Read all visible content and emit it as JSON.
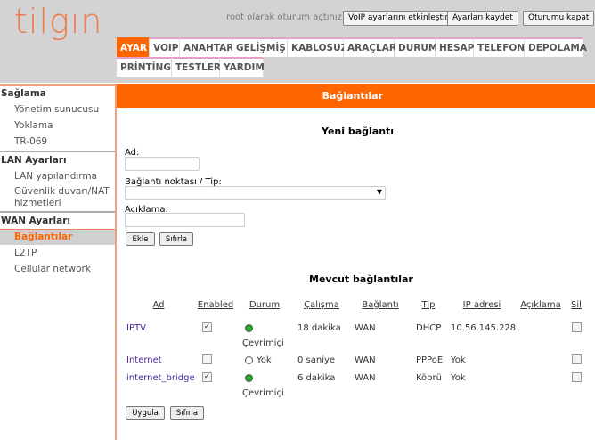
{
  "header": {
    "logo": "tilgın",
    "login_text": "root olarak oturum açtınız.",
    "buttons": [
      "VoIP ayarlarını etkinleştir",
      "Ayarları kaydet",
      "Oturumu kapat"
    ]
  },
  "nav": {
    "row1": [
      "AYAR",
      "VOIP",
      "ANAHTAR",
      "GELİŞMİŞ",
      "KABLOSUZ",
      "ARAÇLAR",
      "DURUM",
      "HESAP",
      "TELEFON",
      "DEPOLAMA"
    ],
    "row2": [
      "PRİNTİNG",
      "TESTLER",
      "YARDIM"
    ],
    "active": "AYAR"
  },
  "sidebar": {
    "sections": [
      {
        "title": "Sağlama",
        "items": [
          "Yönetim sunucusu",
          "Yoklama",
          "TR-069"
        ]
      },
      {
        "title": "LAN Ayarları",
        "items": [
          "LAN yapılandırma",
          "Güvenlik duvarı/NAT hizmetleri"
        ]
      },
      {
        "title": "WAN Ayarları",
        "items": [
          "Bağlantılar",
          "L2TP",
          "Cellular network"
        ]
      }
    ],
    "active": "Bağlantılar"
  },
  "page": {
    "title": "Bağlantılar",
    "new": {
      "heading": "Yeni bağlantı",
      "name_label": "Ad:",
      "name_value": "",
      "type_label": "Bağlantı noktası / Tip:",
      "type_value": "",
      "desc_label": "Açıklama:",
      "desc_value": "",
      "add": "Ekle",
      "reset": "Sıfırla"
    },
    "existing": {
      "heading": "Mevcut bağlantılar",
      "columns": [
        "Ad",
        "Enabled",
        "Durum",
        "Çalışma",
        "Bağlantı",
        "Tip",
        "IP adresi",
        "Açıklama",
        "Sil"
      ],
      "rows": [
        {
          "name": "IPTV",
          "enabled": true,
          "status": "Çevrimiçi",
          "online": true,
          "uptime": "18 dakika",
          "link": "WAN",
          "type": "DHCP",
          "ip": "10.56.145.228",
          "desc": "",
          "delete": false
        },
        {
          "name": "Internet",
          "enabled": false,
          "status": "Yok",
          "online": false,
          "uptime": "0 saniye",
          "link": "WAN",
          "type": "PPPoE",
          "ip": "Yok",
          "desc": "",
          "delete": false
        },
        {
          "name": "internet_bridge",
          "enabled": true,
          "status": "Çevrimiçi",
          "online": true,
          "uptime": "6 dakika",
          "link": "WAN",
          "type": "Köprü",
          "ip": "Yok",
          "desc": "",
          "delete": false
        }
      ],
      "apply": "Uygula",
      "reset": "Sıfırla"
    }
  }
}
